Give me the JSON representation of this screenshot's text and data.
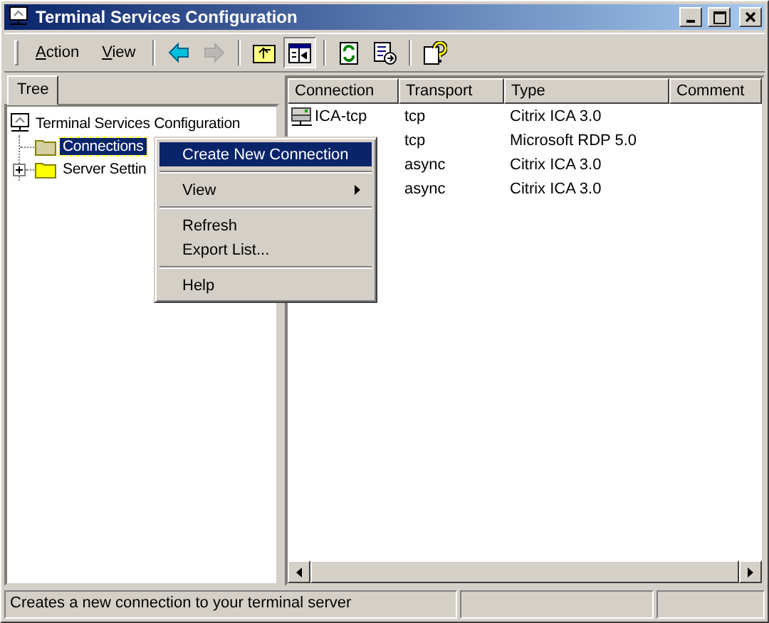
{
  "window": {
    "title": "Terminal Services Configuration"
  },
  "menu_bar": [
    {
      "label": "Action"
    },
    {
      "label": "View"
    }
  ],
  "tool_buttons": [
    {
      "kind": "back",
      "disabled": false,
      "pressed": false
    },
    {
      "kind": "forward",
      "disabled": true,
      "pressed": false
    },
    {
      "kind": "up",
      "disabled": false,
      "pressed": false
    },
    {
      "kind": "tree",
      "disabled": false,
      "pressed": true
    },
    {
      "kind": "refresh",
      "disabled": false,
      "pressed": false
    },
    {
      "kind": "export",
      "disabled": false,
      "pressed": false
    },
    {
      "kind": "help",
      "disabled": false,
      "pressed": false
    }
  ],
  "tabs": [
    {
      "label": "Tree",
      "selected": true
    }
  ],
  "tree": [
    {
      "label": "Terminal Services Configuration",
      "kind": "computer",
      "selected": false,
      "children": [
        {
          "label": "Connections",
          "kind": "folder",
          "selected": true
        },
        {
          "label": "Server Settin",
          "kind": "folder",
          "selected": false,
          "expanded": false
        }
      ]
    }
  ],
  "table": {
    "columns": [
      "Connection",
      "Transport",
      "Type",
      "Comment"
    ],
    "rows": [
      {
        "connection": "ICA-tcp",
        "transport": "tcp",
        "type": "Citrix ICA 3.0"
      },
      {
        "transport": "tcp",
        "type": "Microsoft RDP 5.0"
      },
      {
        "transport": "async",
        "type": "Citrix ICA 3.0"
      },
      {
        "transport": "async",
        "type": "Citrix ICA 3.0"
      }
    ]
  },
  "context_menu": [
    {
      "kind": "item",
      "label": "Create New Connection",
      "selected": true,
      "submenu": false
    },
    {
      "kind": "separator"
    },
    {
      "kind": "item",
      "label": "View",
      "selected": false,
      "submenu": true
    },
    {
      "kind": "separator"
    },
    {
      "kind": "item",
      "label": "Refresh",
      "selected": false,
      "submenu": false
    },
    {
      "kind": "item",
      "label": "Export List...",
      "selected": false,
      "submenu": false
    },
    {
      "kind": "separator"
    },
    {
      "kind": "item",
      "label": "Help",
      "selected": false,
      "submenu": false
    }
  ],
  "status_bar": {
    "text": "Creates a new connection to your terminal server"
  }
}
